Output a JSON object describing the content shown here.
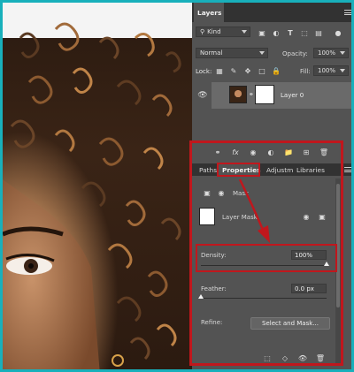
{
  "layers_panel": {
    "tab_label": "Layers",
    "kind_label": "Kind",
    "blend_mode": "Normal",
    "opacity_label": "Opacity:",
    "opacity_value": "100%",
    "lock_label": "Lock:",
    "fill_label": "Fill:",
    "fill_value": "100%",
    "layer_name": "Layer 0",
    "fx_label": "fx"
  },
  "properties_panel": {
    "tabs": [
      "Paths",
      "Properties",
      "Adjustm",
      "Libraries"
    ],
    "mask_header": "Mask",
    "layer_mask_label": "Layer Mask",
    "density_label": "Density:",
    "density_value": "100%",
    "density_level_percent": 100,
    "feather_label": "Feather:",
    "feather_value": "0.0 px",
    "feather_level_percent": 0,
    "refine_label": "Refine:",
    "select_mask_button": "Select and Mask..."
  },
  "colors": {
    "annotation_red": "#c0171d",
    "frame_teal": "#18b0bb",
    "panel_gray": "#535353"
  }
}
